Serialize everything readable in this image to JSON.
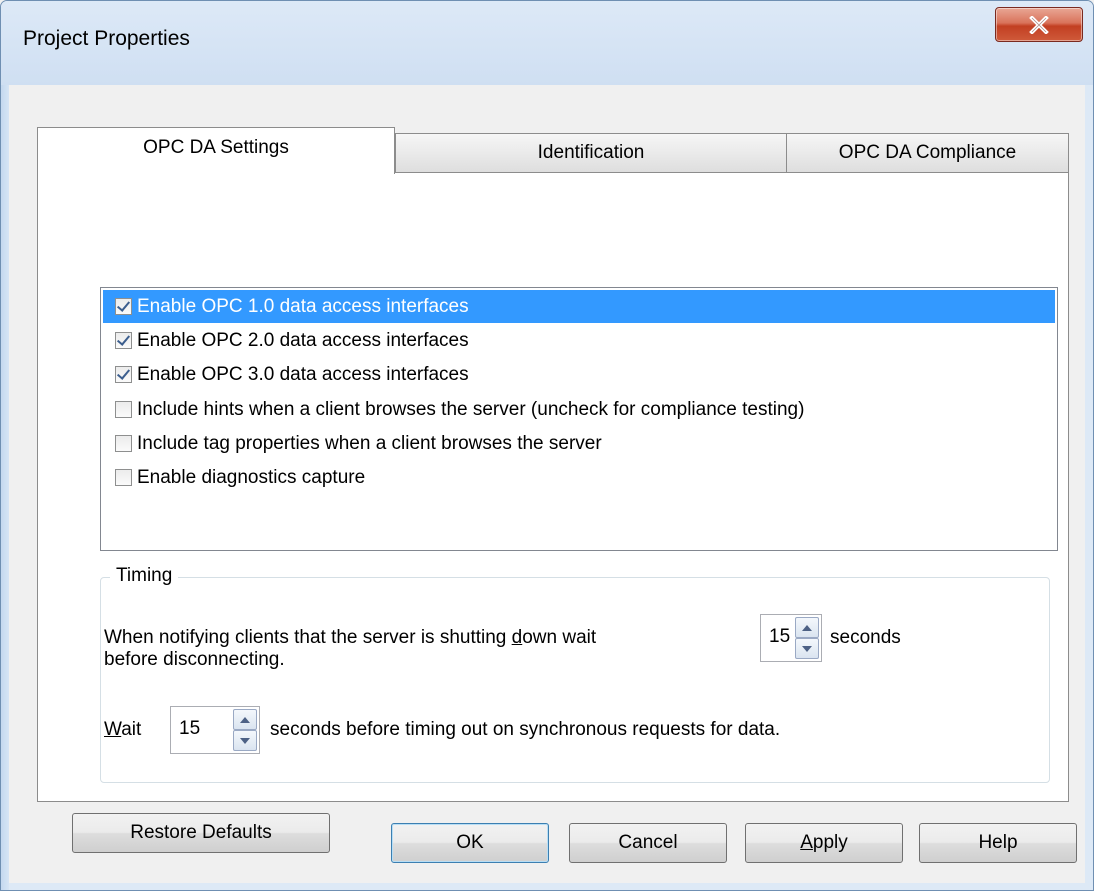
{
  "window": {
    "title": "Project Properties"
  },
  "tabs": [
    {
      "label": "OPC DA Settings",
      "active": true
    },
    {
      "label": "Identification",
      "active": false
    },
    {
      "label": "OPC DA Compliance",
      "active": false
    }
  ],
  "options": [
    {
      "label": "Enable OPC 1.0 data access interfaces",
      "checked": true,
      "selected": true
    },
    {
      "label": "Enable OPC 2.0 data access interfaces",
      "checked": true,
      "selected": false
    },
    {
      "label": "Enable OPC 3.0 data access interfaces",
      "checked": true,
      "selected": false
    },
    {
      "label": "Include hints when a client browses the server (uncheck for compliance testing)",
      "checked": false,
      "selected": false
    },
    {
      "label": "Include tag properties when a client browses the server",
      "checked": false,
      "selected": false
    },
    {
      "label": "Enable diagnostics capture",
      "checked": false,
      "selected": false
    }
  ],
  "timing": {
    "group_label": "Timing",
    "shutdown_line1_pre": "When notifying clients that the server is shutting ",
    "shutdown_line1_access": "d",
    "shutdown_line1_post": "own wait",
    "shutdown_line2": "before disconnecting.",
    "shutdown_value": "15",
    "shutdown_unit": "seconds",
    "wait_access": "W",
    "wait_rest": "ait",
    "wait_value": "15",
    "wait_suffix": "seconds before timing out on synchronous requests for data."
  },
  "buttons": {
    "restore": "Restore Defaults",
    "ok": "OK",
    "cancel": "Cancel",
    "apply_access": "A",
    "apply_rest": "pply",
    "help": "Help"
  },
  "icons": {
    "close": "close-x-icon",
    "spin_up": "arrow-up-icon",
    "spin_down": "arrow-down-icon"
  },
  "colors": {
    "selection": "#3399ff",
    "close_button": "#c7452a"
  }
}
